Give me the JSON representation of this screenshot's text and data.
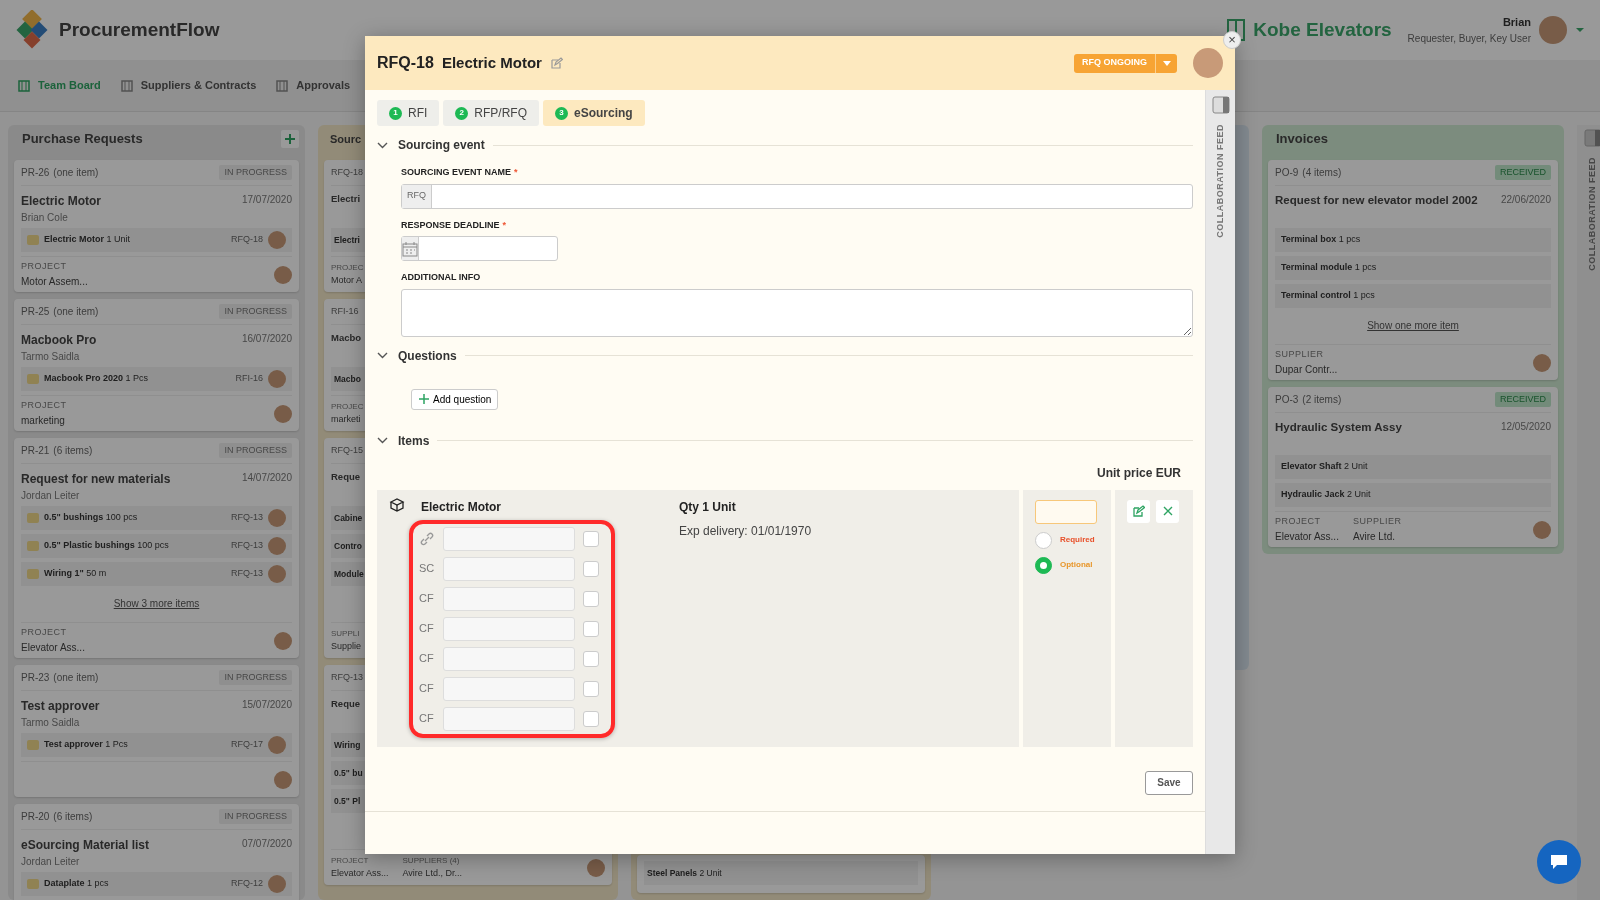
{
  "app": {
    "name": "ProcurementFlow",
    "company": "Kobe Elevators",
    "user": {
      "name": "Brian",
      "roles": "Requester, Buyer, Key User"
    }
  },
  "nav": [
    {
      "label": "Team Board",
      "selected": true
    },
    {
      "label": "Suppliers & Contracts",
      "selected": false
    },
    {
      "label": "Approvals",
      "selected": false
    }
  ],
  "board": {
    "columns": [
      {
        "kind": "requests",
        "title": "Purchase Requests",
        "cards": [
          {
            "code": "PR-26",
            "count": "(one item)",
            "status": "IN PROGRESS",
            "title": "Electric Motor",
            "date": "17/07/2020",
            "person": "Brian Cole",
            "items": [
              {
                "name": "Electric Motor",
                "qty": "1 Unit",
                "ref": "RFQ-18"
              }
            ],
            "footer": [
              {
                "label": "PROJECT",
                "value": "Motor Assem..."
              }
            ]
          },
          {
            "code": "PR-25",
            "count": "(one item)",
            "status": "IN PROGRESS",
            "title": "Macbook Pro",
            "date": "16/07/2020",
            "person": "Tarmo Saidla",
            "items": [
              {
                "name": "Macbook Pro 2020",
                "qty": "1 Pcs",
                "ref": "RFI-16"
              }
            ],
            "footer": [
              {
                "label": "PROJECT",
                "value": "marketing"
              }
            ]
          },
          {
            "code": "PR-21",
            "count": "(6 items)",
            "status": "IN PROGRESS",
            "title": "Request for new materials",
            "date": "14/07/2020",
            "person": "Jordan Leiter",
            "items": [
              {
                "name": "0.5\" bushings",
                "qty": "100 pcs",
                "ref": "RFQ-13"
              },
              {
                "name": "0.5\" Plastic bushings",
                "qty": "100 pcs",
                "ref": "RFQ-13"
              },
              {
                "name": "Wiring 1\"",
                "qty": "50 m",
                "ref": "RFQ-13"
              }
            ],
            "more": "Show 3 more items",
            "footer": [
              {
                "label": "PROJECT",
                "value": "Elevator Ass..."
              }
            ]
          },
          {
            "code": "PR-23",
            "count": "(one item)",
            "status": "IN PROGRESS",
            "title": "Test approver",
            "date": "15/07/2020",
            "person": "Tarmo Saidla",
            "items": [
              {
                "name": "Test approver",
                "qty": "1 Pcs",
                "ref": "RFQ-17"
              }
            ]
          },
          {
            "code": "PR-20",
            "count": "(6 items)",
            "status": "IN PROGRESS",
            "title": "eSourcing Material list",
            "date": "07/07/2020",
            "person": "Jordan Leiter",
            "items": [
              {
                "name": "Dataplate",
                "qty": "1 pcs",
                "ref": "RFQ-12"
              }
            ]
          }
        ]
      },
      {
        "kind": "sourcing",
        "title": "Sourc",
        "cards": [
          {
            "code": "RFQ-18",
            "title": "Electri",
            "items": [
              {
                "name": "Electri"
              }
            ],
            "footer": [
              {
                "label": "PROJEC",
                "value": "Motor A"
              }
            ]
          },
          {
            "code": "RFI-16",
            "title": "Macbo",
            "items": [
              {
                "name": "Macbo"
              }
            ],
            "footer": [
              {
                "label": "PROJEC",
                "value": "marketi"
              }
            ]
          },
          {
            "code": "RFQ-15",
            "title": "Reque",
            "items": [
              {
                "name": "Cabine"
              },
              {
                "name": "Contro"
              },
              {
                "name": "Module"
              }
            ],
            "footer": [
              {
                "label": "SUPPLI",
                "value": "Supplie"
              }
            ]
          },
          {
            "code": "RFQ-13",
            "title": "Reque",
            "items": [
              {
                "name": "Wiring"
              },
              {
                "name": "0.5\" bu"
              },
              {
                "name": "0.5\" Pl"
              }
            ],
            "footer": [
              {
                "label": "PROJECT",
                "value": "Elevator Ass..."
              },
              {
                "label": "SUPPLIERS (4)",
                "value": "Avire Ltd., Dr..."
              }
            ]
          }
        ]
      },
      {
        "kind": "sourcing",
        "cards": [
          {
            "items": [
              {
                "name": "Steel Panels",
                "qty": "2 Unit"
              }
            ]
          }
        ]
      },
      {
        "kind": "other"
      },
      {
        "kind": "invoices",
        "title": "Invoices",
        "cards": [
          {
            "code": "PO-9",
            "count": "(4 items)",
            "status": "RECEIVED",
            "title": "Request for new elevator model 2002",
            "date": "22/06/2020",
            "items": [
              {
                "name": "Terminal box",
                "qty": "1 pcs"
              },
              {
                "name": "Terminal module",
                "qty": "1 pcs"
              },
              {
                "name": "Terminal control",
                "qty": "1 pcs"
              }
            ],
            "more": "Show one more item",
            "footer": [
              {
                "label": "SUPPLIER",
                "value": "Dupar Contr..."
              }
            ]
          },
          {
            "code": "PO-3",
            "count": "(2 items)",
            "status": "RECEIVED",
            "title": "Hydraulic System Assy",
            "date": "12/05/2020",
            "items": [
              {
                "name": "Elevator Shaft",
                "qty": "2 Unit"
              },
              {
                "name": "Hydraulic Jack",
                "qty": "2 Unit"
              }
            ],
            "footer": [
              {
                "label": "PROJECT",
                "value": "Elevator Ass..."
              },
              {
                "label": "SUPPLIER",
                "value": "Avire Ltd."
              }
            ]
          }
        ]
      }
    ]
  },
  "side_panel": {
    "label": "COLLABORATION FEED"
  },
  "modal": {
    "code": "RFQ-18",
    "title": "Electric Motor",
    "status": "RFQ ONGOING",
    "close": "×",
    "tabs": [
      {
        "number": "1",
        "label": "RFI",
        "selected": false
      },
      {
        "number": "2",
        "label": "RFP/RFQ",
        "selected": false
      },
      {
        "number": "3",
        "label": "eSourcing",
        "selected": true
      }
    ],
    "sections": [
      {
        "kind": "form",
        "title": "Sourcing event",
        "expanded": true,
        "fields": [
          {
            "kind": "prefixed",
            "label": "SOURCING EVENT NAME",
            "required_mark": "*",
            "prefix": "RFQ"
          },
          {
            "kind": "date",
            "label": "RESPONSE DEADLINE",
            "required_mark": "*"
          },
          {
            "kind": "textarea",
            "label": "ADDITIONAL INFO"
          }
        ]
      },
      {
        "kind": "questions",
        "title": "Questions",
        "expanded": true,
        "button": "Add question"
      },
      {
        "kind": "items",
        "title": "Items",
        "expanded": true,
        "price_header": "Unit price EUR",
        "items": [
          {
            "name": "Electric Motor",
            "qty": "Qty 1 Unit",
            "delivery": "Exp delivery: 01/01/1970",
            "fields": [
              {
                "kind": "link",
                "checked": false
              },
              {
                "kind": "code",
                "label": "SC",
                "checked": false
              },
              {
                "kind": "code",
                "label": "CF",
                "checked": false
              },
              {
                "kind": "code",
                "label": "CF",
                "checked": false
              },
              {
                "kind": "code",
                "label": "CF",
                "checked": false
              },
              {
                "kind": "code",
                "label": "CF",
                "checked": false
              },
              {
                "kind": "code",
                "label": "CF",
                "checked": false
              }
            ],
            "options": [
              {
                "kind": "required",
                "label": "Required",
                "selected": false
              },
              {
                "kind": "optional",
                "label": "Optional",
                "selected": true
              }
            ]
          }
        ]
      }
    ],
    "save": "Save",
    "feed": "COLLABORATION FEED"
  }
}
